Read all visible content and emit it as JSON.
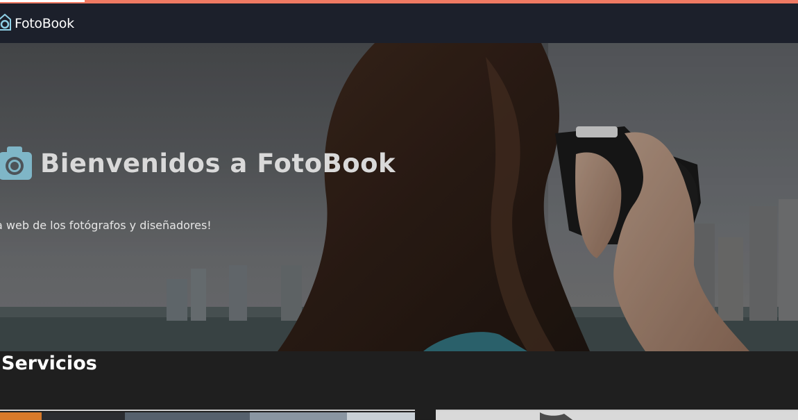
{
  "navbar": {
    "brand_text": "FotoBook",
    "brand_icon": "camera-logo-icon"
  },
  "hero": {
    "title": "Bienvenidos a FotoBook",
    "title_icon": "camera-icon",
    "subtitle": "a web de los fotógrafos y diseñadores!"
  },
  "services": {
    "title": "Servicios"
  },
  "colors": {
    "accent_bar": "#f07a63",
    "navbar_bg": "#1c202b",
    "camera_icon": "#7fb6c7",
    "section_bg": "#1f1f1f"
  }
}
